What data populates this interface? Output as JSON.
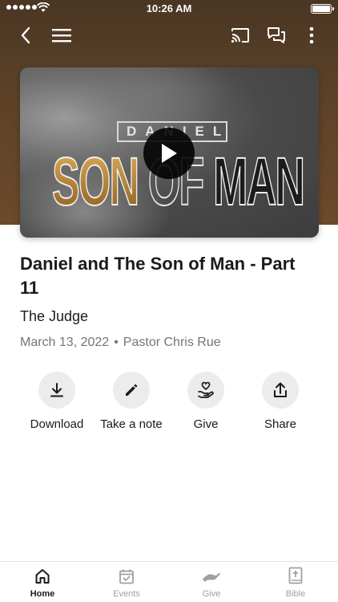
{
  "status_bar": {
    "time": "10:26 AM"
  },
  "video": {
    "art_top": "DANIEL",
    "art_title_1": "SON",
    "art_title_2": "OF",
    "art_title_3": "MAN"
  },
  "sermon": {
    "title": "Daniel  and The Son of Man - Part 11",
    "subtitle": "The Judge",
    "date": "March 13, 2022",
    "separator": "•",
    "speaker": "Pastor Chris Rue"
  },
  "actions": [
    {
      "label": "Download",
      "icon": "download-icon"
    },
    {
      "label": "Take a note",
      "icon": "pencil-icon"
    },
    {
      "label": "Give",
      "icon": "heart-hand-icon"
    },
    {
      "label": "Share",
      "icon": "share-icon"
    }
  ],
  "tabs": [
    {
      "label": "Home",
      "icon": "home-icon",
      "active": true
    },
    {
      "label": "Events",
      "icon": "calendar-icon",
      "active": false
    },
    {
      "label": "Give",
      "icon": "give-hand-icon",
      "active": false
    },
    {
      "label": "Bible",
      "icon": "bible-icon",
      "active": false
    }
  ],
  "colors": {
    "header_brown": "#5c4128",
    "action_circle": "#ececec",
    "meta_gray": "#757575",
    "tab_inactive": "#a0a0a0"
  }
}
